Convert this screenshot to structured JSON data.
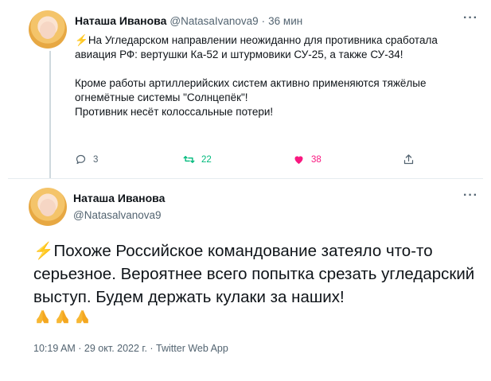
{
  "tweet1": {
    "name": "Наташа Иванова",
    "handle": "@NatasaIvanova9",
    "separator": "·",
    "time": "36 мин",
    "more_label": "···",
    "text_icon": "⚡",
    "text": "На Угледарском направлении неожиданно для противника сработала авиация РФ: вертушки Ка-52 и штурмовики СУ-25, а также СУ-34!\n\nКроме работы артиллерийских систем активно применяются тяжёлые огнемётные системы \"Солнцепёк\"!\nПротивник несёт колоссальные потери!",
    "actions": {
      "reply_count": "3",
      "retweet_count": "22",
      "like_count": "38"
    }
  },
  "tweet2": {
    "name": "Наташа Иванова",
    "handle": "@Natasalvanova9",
    "more_label": "···",
    "text_icon": "⚡",
    "text": "Похоже Российское командование затеяло что-то серьезное. Вероятнее всего попытка срезать угледарский выступ. Будем держать кулаки за наших!",
    "emoji": [
      "pray",
      "pray",
      "pray"
    ],
    "meta": "10:19 AM · 29 окт. 2022 г. · Twitter Web App"
  },
  "colors": {
    "accent_green": "#00ba7c",
    "like_pink": "#f91880",
    "muted": "#536471",
    "bolt": "#f4b400"
  }
}
